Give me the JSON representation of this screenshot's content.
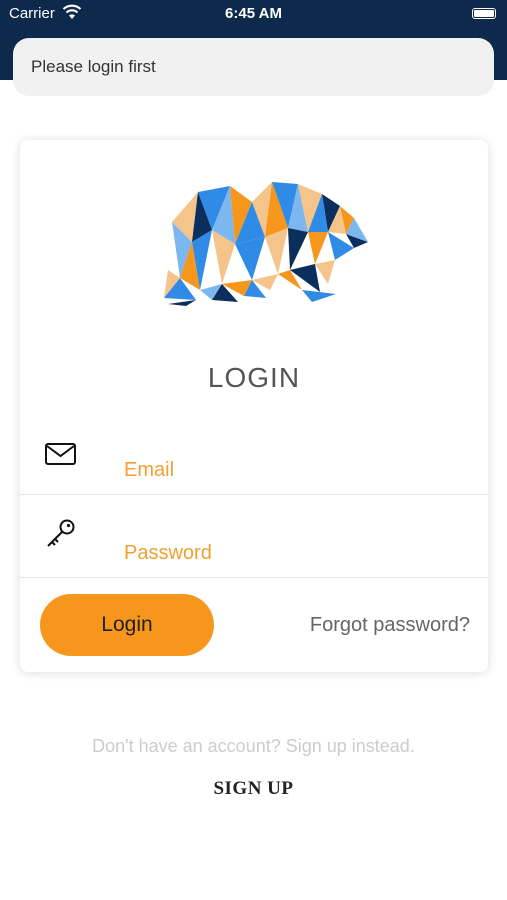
{
  "status_bar": {
    "carrier": "Carrier",
    "time": "6:45 AM"
  },
  "toast": {
    "message": "Please login first"
  },
  "login_card": {
    "title": "LOGIN",
    "email": {
      "placeholder": "Email",
      "value": "",
      "icon": "envelope-icon"
    },
    "password": {
      "placeholder": "Password",
      "value": "",
      "icon": "key-icon"
    },
    "login_button": "Login",
    "forgot_password": "Forgot password?"
  },
  "signup": {
    "hint": "Don't have an account? Sign up instead.",
    "link": "SIGN UP"
  },
  "colors": {
    "status_bar": "#0d2a4c",
    "accent": "#f7961d",
    "placeholder": "#f0a030",
    "logo_blue": "#2f8be6",
    "logo_dark": "#0b2e5c"
  }
}
